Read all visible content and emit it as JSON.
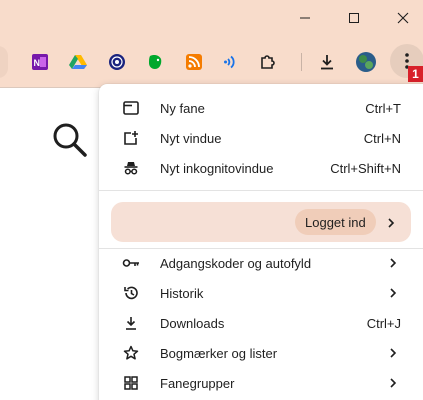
{
  "window": {
    "controls": [
      "minimize",
      "maximize",
      "close"
    ],
    "accent_color": "#f8dccb"
  },
  "toolbar": {
    "extensions": [
      {
        "icon": "onenote-icon",
        "color": "#7719aa"
      },
      {
        "icon": "google-drive-icon",
        "color": "#1fa463"
      },
      {
        "icon": "vpn-shield-icon",
        "color": "#1a237e"
      },
      {
        "icon": "evernote-icon",
        "color": "#00a82d"
      },
      {
        "icon": "rss-feed-icon",
        "color": "#f57c00"
      },
      {
        "icon": "read-aloud-icon",
        "color": "#1a73e8"
      },
      {
        "icon": "extensions-puzzle-icon",
        "color": "#1f1f1f"
      }
    ],
    "download_icon": "download-icon",
    "profile_icon": "profile-avatar-icon",
    "menu_icon": "more-vert-icon",
    "badge": "1"
  },
  "menu": {
    "group1": [
      {
        "label": "Ny fane",
        "shortcut": "Ctrl+T",
        "icon": "new-tab-icon"
      },
      {
        "label": "Nyt vindue",
        "shortcut": "Ctrl+N",
        "icon": "new-window-icon"
      },
      {
        "label": "Nyt inkognitovindue",
        "shortcut": "Ctrl+Shift+N",
        "icon": "incognito-icon"
      }
    ],
    "profile": {
      "status": "Logget ind"
    },
    "group2": [
      {
        "label": "Adgangskoder og autofyld",
        "icon": "key-icon",
        "submenu": true
      },
      {
        "label": "Historik",
        "icon": "history-icon",
        "submenu": true
      },
      {
        "label": "Downloads",
        "shortcut": "Ctrl+J",
        "icon": "download-icon"
      },
      {
        "label": "Bogmærker og lister",
        "icon": "star-icon",
        "submenu": true
      },
      {
        "label": "Fanegrupper",
        "icon": "tab-groups-icon",
        "submenu": true
      }
    ]
  }
}
